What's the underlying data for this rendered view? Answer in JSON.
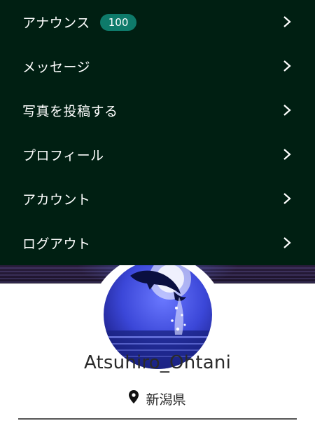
{
  "menu": {
    "items": [
      {
        "label": "アナウンス",
        "badge": "100",
        "icon": "chevron-right-icon"
      },
      {
        "label": "メッセージ",
        "icon": "chevron-right-icon"
      },
      {
        "label": "写真を投稿する",
        "icon": "chevron-right-icon"
      },
      {
        "label": "プロフィール",
        "icon": "chevron-right-icon"
      },
      {
        "label": "アカウント",
        "icon": "chevron-right-icon"
      },
      {
        "label": "ログアウト",
        "icon": "chevron-right-icon"
      }
    ]
  },
  "profile": {
    "username": "Atsuhiro_Ohtani",
    "location": "新潟県",
    "location_icon": "map-pin-icon"
  },
  "colors": {
    "menu_bg": "#001f12",
    "badge_bg": "#0e7a6a",
    "text_light": "#ffffff",
    "text_dark": "#2a2a2a"
  }
}
